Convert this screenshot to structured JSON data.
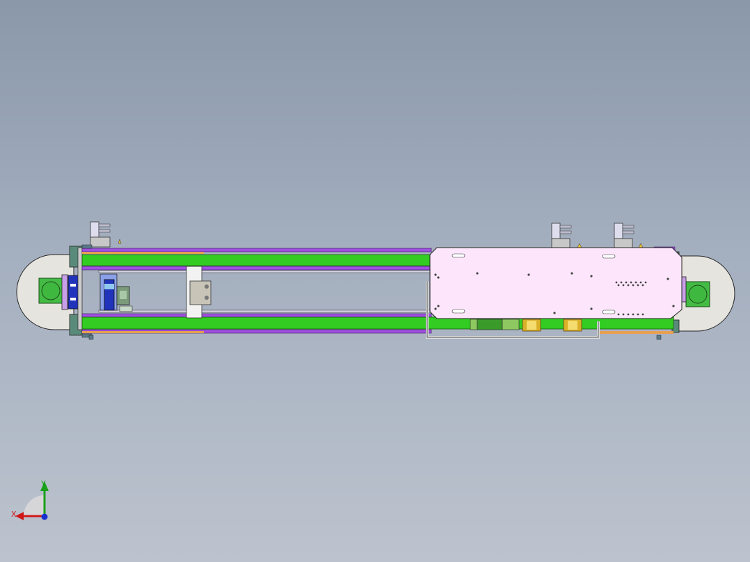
{
  "viewport": {
    "background_top": "#8a98aa",
    "background_bottom": "#bcc3ce"
  },
  "colors": {
    "belt_green": "#33cc22",
    "rail_purple": "#a050e0",
    "carriage_pink": "#fde6fb",
    "housing_grey": "#e6e4de",
    "motor_green": "#44bb44",
    "bracket_blue": "#2233bb",
    "roller_gold": "#d9b028"
  },
  "triad": {
    "x_label": "X",
    "y_label": "Y",
    "x_color": "#d01818",
    "y_color": "#18a018",
    "z_color": "#1830d0"
  }
}
